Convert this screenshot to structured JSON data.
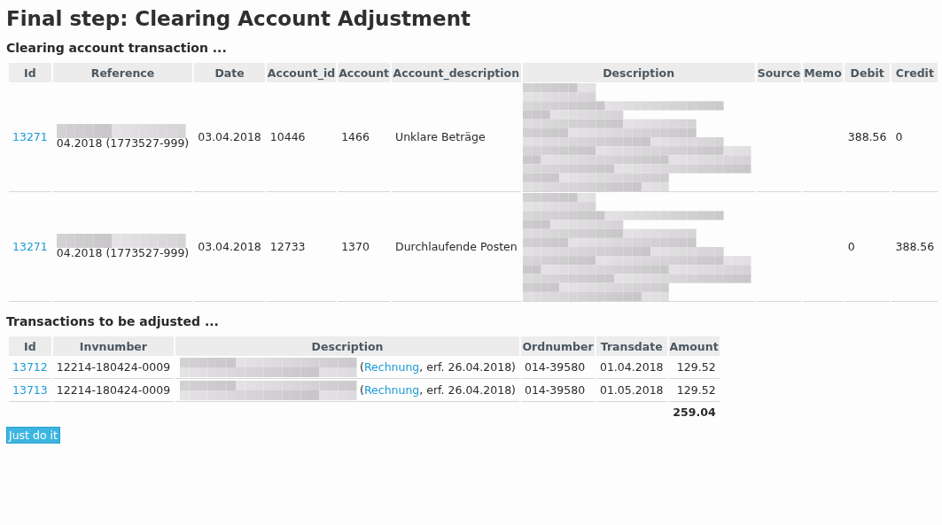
{
  "title": "Final step: Clearing Account Adjustment",
  "clearing": {
    "heading": "Clearing account transaction ...",
    "columns": [
      "Id",
      "Reference",
      "Date",
      "Account_id",
      "Account",
      "Account_description",
      "Description",
      "Source",
      "Memo",
      "Debit",
      "Credit"
    ],
    "rows": [
      {
        "id": "13271",
        "reference": "04.2018 (1773527-999)",
        "date": "03.04.2018",
        "account_id": "10446",
        "account": "1466",
        "account_description": "Unklare Beträge",
        "debit": "388.56",
        "credit": "0"
      },
      {
        "id": "13271",
        "reference": "04.2018 (1773527-999)",
        "date": "03.04.2018",
        "account_id": "12733",
        "account": "1370",
        "account_description": "Durchlaufende Posten",
        "debit": "0",
        "credit": "388.56"
      }
    ]
  },
  "adjust": {
    "heading": "Transactions to be adjusted ...",
    "columns": [
      "Id",
      "Invnumber",
      "Description",
      "Ordnumber",
      "Transdate",
      "Amount"
    ],
    "rows": [
      {
        "id": "13712",
        "invnumber": "12214-180424-0009",
        "desc_open": "(",
        "desc_link": "Rechnung",
        "desc_rest": ", erf. 26.04.2018)",
        "ordnumber": "014-39580",
        "transdate": "01.04.2018",
        "amount": "129.52"
      },
      {
        "id": "13713",
        "invnumber": "12214-180424-0009",
        "desc_open": "(",
        "desc_link": "Rechnung",
        "desc_rest": ", erf. 26.04.2018)",
        "ordnumber": "014-39580",
        "transdate": "01.05.2018",
        "amount": "129.52"
      }
    ],
    "total": "259.04"
  },
  "button": "Just do it"
}
